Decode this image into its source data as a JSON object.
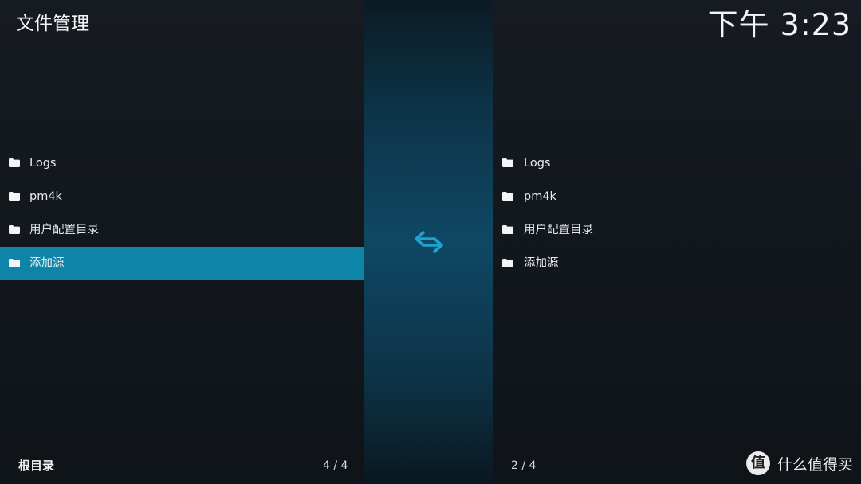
{
  "header": {
    "title": "文件管理",
    "clock": "下午 3:23"
  },
  "left_pane": {
    "items": [
      {
        "label": "Logs",
        "icon": "folder-icon",
        "selected": false
      },
      {
        "label": "pm4k",
        "icon": "folder-icon",
        "selected": false
      },
      {
        "label": "用户配置目录",
        "icon": "folder-icon",
        "selected": false
      },
      {
        "label": "添加源",
        "icon": "folder-icon",
        "selected": true
      }
    ],
    "path": "根目录",
    "counter": "4 / 4"
  },
  "right_pane": {
    "items": [
      {
        "label": "Logs",
        "icon": "folder-icon",
        "selected": false
      },
      {
        "label": "pm4k",
        "icon": "folder-icon",
        "selected": false
      },
      {
        "label": "用户配置目录",
        "icon": "folder-icon",
        "selected": false
      },
      {
        "label": "添加源",
        "icon": "folder-icon",
        "selected": false
      }
    ],
    "counter": "2 / 4"
  },
  "center": {
    "icon": "swap-arrows-icon"
  },
  "watermark": {
    "logo_glyph": "值",
    "text": "什么值得买"
  },
  "colors": {
    "background": "#12171d",
    "selection": "#0e84a8",
    "accent": "#1fa2cf",
    "center_strip": "#0f4864",
    "text": "#e8ecef"
  }
}
